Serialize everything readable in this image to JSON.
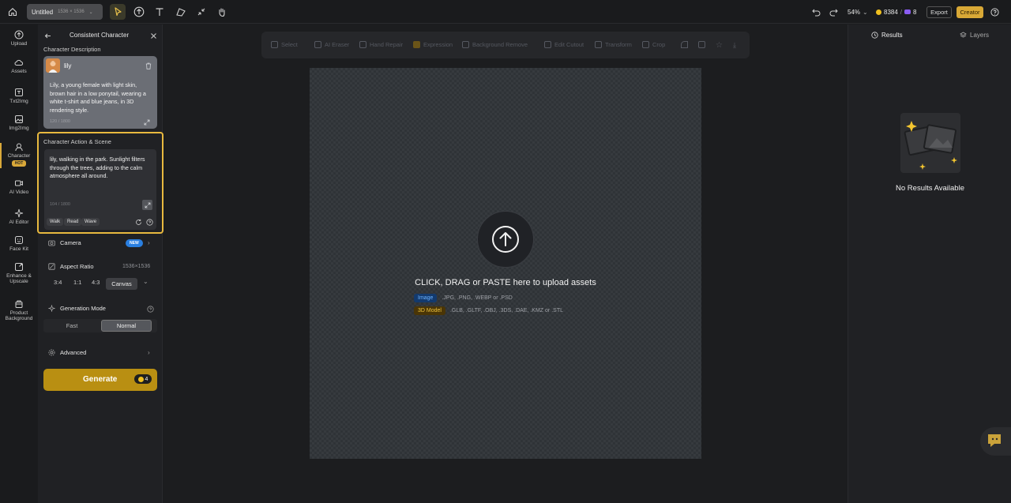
{
  "topbar": {
    "doc_title": "Untitled",
    "doc_size": "1536 × 1536",
    "zoom": "54%",
    "credits": "8384",
    "gems": "8",
    "export_label": "Export",
    "creator_label": "Creator"
  },
  "sidebar": {
    "items": [
      {
        "label": "Upload",
        "icon": "upload-icon"
      },
      {
        "label": "Assets",
        "icon": "cloud-icon"
      },
      {
        "label": "Txt2Img",
        "icon": "text-image-icon"
      },
      {
        "label": "Img2Img",
        "icon": "image-image-icon"
      },
      {
        "label": "Character",
        "icon": "character-icon",
        "badge": "HOT"
      },
      {
        "label": "AI Video",
        "icon": "video-icon"
      },
      {
        "label": "AI Editor",
        "icon": "sparkle-icon"
      },
      {
        "label": "Face Kit",
        "icon": "face-icon"
      },
      {
        "label": "Enhance & Upscale",
        "icon": "enhance-icon"
      },
      {
        "label": "Product Background",
        "icon": "product-icon"
      }
    ]
  },
  "panel": {
    "title": "Consistent Character",
    "description_label": "Character Description",
    "character_name": "lily",
    "description_text": "Lily, a young female with light skin, brown hair in a low ponytail, wearing a white t-shirt and blue jeans, in 3D rendering style.",
    "description_count": "120 / 1800",
    "action_label": "Character Action & Scene",
    "action_text": "lily, walking in the park. Sunlight filters through the trees, adding to the calm atmosphere all around.",
    "action_count": "104 / 1800",
    "chips": [
      "Walk",
      "Read",
      "Wave"
    ],
    "camera_label": "Camera",
    "camera_badge": "NEW",
    "aspect_label": "Aspect Ratio",
    "aspect_value": "1536×1536",
    "ratios": [
      "3:4",
      "1:1",
      "4:3"
    ],
    "ratio_selected": "Canvas",
    "mode_label": "Generation Mode",
    "mode_fast": "Fast",
    "mode_normal": "Normal",
    "advanced_label": "Advanced",
    "generate_label": "Generate",
    "generate_cost": "4"
  },
  "toolbar": {
    "items": [
      "Select",
      "AI Eraser",
      "Hand Repair",
      "Expression",
      "Background Remove",
      "Edit Cutout",
      "Transform",
      "Crop"
    ]
  },
  "canvas": {
    "upload_heading": "CLICK, DRAG or PASTE here to upload assets",
    "image_tag": "Image",
    "image_formats": ".JPG, .PNG, .WEBP or .PSD",
    "model_tag": "3D Model",
    "model_formats": ".GLB, .GLTF, .OBJ, .3DS, .DAE, .KMZ or .STL"
  },
  "right_panel": {
    "tab_results": "Results",
    "tab_layers": "Layers",
    "empty_text": "No Results Available"
  },
  "colors": {
    "accent": "#d9a839",
    "generate": "#b98f12",
    "highlight_border": "#e8b93f"
  }
}
